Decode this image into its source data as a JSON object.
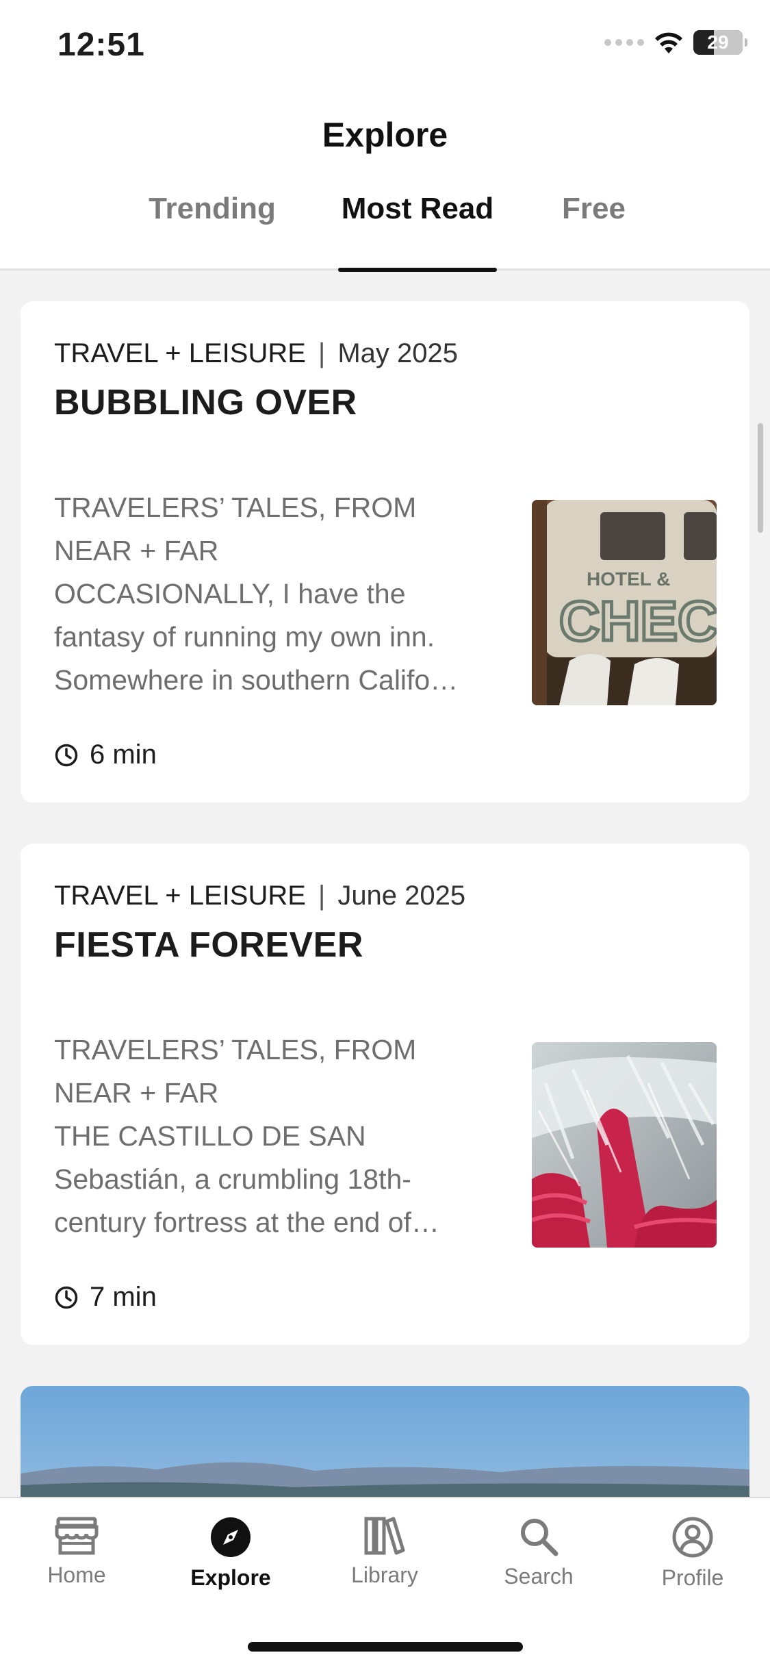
{
  "status_bar": {
    "time": "12:51",
    "battery": "29"
  },
  "header": {
    "title": "Explore",
    "tabs": [
      {
        "label": "Trending",
        "active": false
      },
      {
        "label": "Most Read",
        "active": true
      },
      {
        "label": "Free",
        "active": false
      }
    ]
  },
  "articles": [
    {
      "publication": "TRAVEL + LEISURE",
      "separator": "|",
      "date": "May 2025",
      "title": "BUBBLING OVER",
      "excerpt_lines": [
        "TRAVELERS’ TALES, FROM",
        "NEAR + FAR",
        "OCCASIONALLY, I have the",
        "fantasy of running my own inn.",
        "Somewhere in southern Califo…"
      ],
      "read_time": "6 min"
    },
    {
      "publication": "TRAVEL + LEISURE",
      "separator": "|",
      "date": "June 2025",
      "title": "FIESTA FOREVER",
      "excerpt_lines": [
        "TRAVELERS’ TALES, FROM",
        "NEAR + FAR",
        "THE CASTILLO DE SAN",
        "Sebastián, a crumbling 18th-",
        "century fortress at the end of…"
      ],
      "read_time": "7 min"
    }
  ],
  "bottom_nav": [
    {
      "label": "Home",
      "icon": "storefront-icon",
      "active": false
    },
    {
      "label": "Explore",
      "icon": "compass-icon",
      "active": true
    },
    {
      "label": "Library",
      "icon": "books-icon",
      "active": false
    },
    {
      "label": "Search",
      "icon": "search-icon",
      "active": false
    },
    {
      "label": "Profile",
      "icon": "profile-icon",
      "active": false
    }
  ],
  "colors": {
    "background": "#f2f2f2",
    "card": "#ffffff",
    "text_primary": "#1c1c1c",
    "text_secondary": "#6e6e6e",
    "tab_inactive": "#7b7b7b"
  }
}
